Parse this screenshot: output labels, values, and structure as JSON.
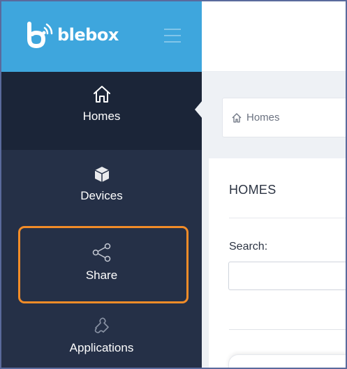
{
  "brand": {
    "name": "blebox",
    "logo_icon": "blebox-logo-icon"
  },
  "colors": {
    "brand_blue": "#3ea6dd",
    "sidebar_bg": "#253047",
    "sidebar_active_bg": "#1b2538",
    "highlight": "#f28c28"
  },
  "sidebar": {
    "items": [
      {
        "label": "Homes",
        "icon": "home-icon",
        "active": true
      },
      {
        "label": "Devices",
        "icon": "cube-icon",
        "active": false
      },
      {
        "label": "Share",
        "icon": "share-icon",
        "active": false
      },
      {
        "label": "Applications",
        "icon": "puzzle-icon",
        "active": false
      }
    ]
  },
  "breadcrumb": {
    "label": "Homes",
    "icon": "home-icon"
  },
  "panel": {
    "title": "HOMES",
    "search_label": "Search:",
    "search_value": ""
  }
}
